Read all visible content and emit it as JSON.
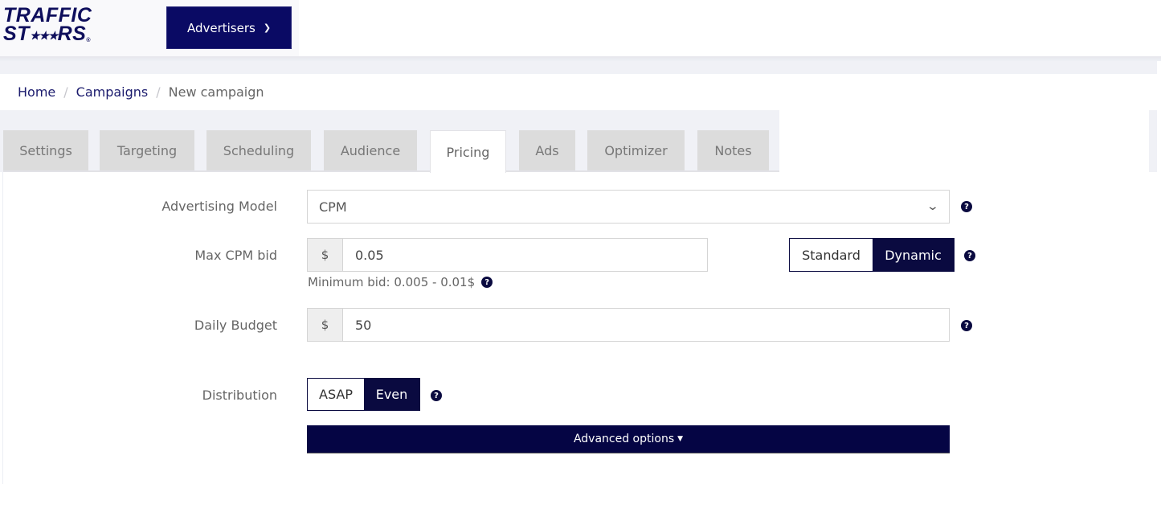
{
  "header": {
    "logo_line1": "TRAFFIC",
    "logo_line2_left": "ST",
    "logo_stars": "★★★",
    "logo_line2_right": "RS",
    "logo_reg": "®",
    "menu_button": "Advertisers",
    "menu_chevron": "⌄"
  },
  "breadcrumb": {
    "items": [
      "Home",
      "Campaigns",
      "New campaign"
    ],
    "separator": "/"
  },
  "tabs": [
    {
      "label": "Settings",
      "active": false
    },
    {
      "label": "Targeting",
      "active": false
    },
    {
      "label": "Scheduling",
      "active": false
    },
    {
      "label": "Audience",
      "active": false
    },
    {
      "label": "Pricing",
      "active": true
    },
    {
      "label": "Ads",
      "active": false
    },
    {
      "label": "Optimizer",
      "active": false
    },
    {
      "label": "Notes",
      "active": false
    }
  ],
  "form": {
    "advertising_model": {
      "label": "Advertising Model",
      "value": "CPM",
      "chevron": "⌄"
    },
    "max_cpm_bid": {
      "label": "Max CPM bid",
      "currency": "$",
      "value": "0.05",
      "hint": "Minimum bid: 0.005 - 0.01$",
      "mode_options": [
        "Standard",
        "Dynamic"
      ],
      "mode_selected": "Dynamic"
    },
    "daily_budget": {
      "label": "Daily Budget",
      "currency": "$",
      "value": "50"
    },
    "distribution": {
      "label": "Distribution",
      "options": [
        "ASAP",
        "Even"
      ],
      "selected": "Even"
    },
    "advanced_options": {
      "label": "Advanced options",
      "caret": "▼"
    },
    "help_glyph": "?"
  },
  "colors": {
    "brand_navy": "#0a0a64",
    "toggle_active": "#0a0a40",
    "advanced_bar": "#050544",
    "tab_inactive": "#dcdcdc",
    "link": "#1c1c6e"
  }
}
